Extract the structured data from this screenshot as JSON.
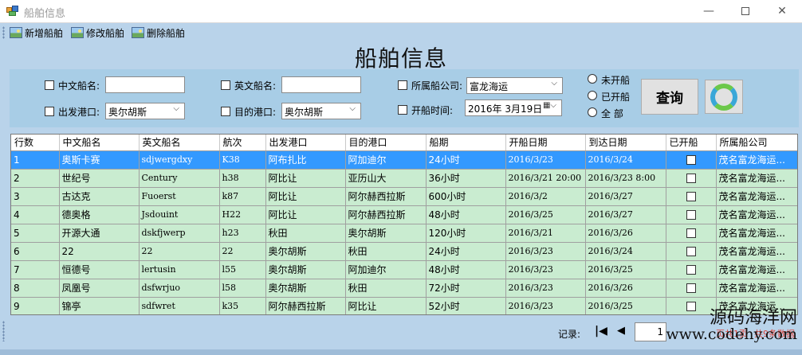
{
  "window": {
    "title": "船舶信息",
    "min": "—",
    "close": "✕"
  },
  "toolbar": {
    "add": "新增船舶",
    "edit": "修改船舶",
    "delete": "删除船舶"
  },
  "heading": "船舶信息",
  "filters": {
    "cn_name_label": "中文船名:",
    "en_name_label": "英文船名:",
    "company_label": "所属船公司:",
    "company_value": "富龙海运",
    "depart_label": "出发港口:",
    "depart_value": "奥尔胡斯",
    "dest_label": "目的港口:",
    "dest_value": "奥尔胡斯",
    "time_label": "开船时间:",
    "time_value": "2016年  3月19日",
    "radio_unsailed": "未开船",
    "radio_sailed": "已开船",
    "radio_all": "全  部",
    "query": "查询"
  },
  "grid": {
    "columns": [
      "行数",
      "中文船名",
      "英文船名",
      "航次",
      "出发港口",
      "目的港口",
      "船期",
      "开船日期",
      "到达日期",
      "已开船",
      "所属船公司"
    ],
    "rows": [
      [
        "1",
        "奥斯卡赛",
        "sdjwergdxy",
        "K38",
        "阿布扎比",
        "阿加迪尔",
        "24小时",
        "2016/3/23",
        "2016/3/24",
        "",
        "茂名富龙海运..."
      ],
      [
        "2",
        "世纪号",
        "Century",
        "h38",
        "阿比让",
        "亚历山大",
        "36小时",
        "2016/3/21 20:00",
        "2016/3/23 8:00",
        "",
        "茂名富龙海运..."
      ],
      [
        "3",
        "古达克",
        "Fuoerst",
        "k87",
        "阿比让",
        "阿尔赫西拉斯",
        "600小时",
        "2016/3/2",
        "2016/3/27",
        "",
        "茂名富龙海运..."
      ],
      [
        "4",
        "德奥格",
        "Jsdouint",
        "H22",
        "阿比让",
        "阿尔赫西拉斯",
        "48小时",
        "2016/3/25",
        "2016/3/27",
        "",
        "茂名富龙海运..."
      ],
      [
        "5",
        "开源大通",
        "dskfjwerp",
        "h23",
        "秋田",
        "奥尔胡斯",
        "120小时",
        "2016/3/21",
        "2016/3/26",
        "",
        "茂名富龙海运..."
      ],
      [
        "6",
        "22",
        "22",
        "22",
        "奥尔胡斯",
        "秋田",
        "24小时",
        "2016/3/23",
        "2016/3/24",
        "",
        "茂名富龙海运..."
      ],
      [
        "7",
        "恒德号",
        "lertusin",
        "l55",
        "奥尔胡斯",
        "阿加迪尔",
        "48小时",
        "2016/3/23",
        "2016/3/25",
        "",
        "茂名富龙海运..."
      ],
      [
        "8",
        "凤凰号",
        "dsfwrjuo",
        "l58",
        "奥尔胡斯",
        "秋田",
        "72小时",
        "2016/3/23",
        "2016/3/26",
        "",
        "茂名富龙海运..."
      ],
      [
        "9",
        "锦亭",
        "sdfwret",
        "k35",
        "阿尔赫西拉斯",
        "阿比让",
        "52小时",
        "2016/3/23",
        "2016/3/25",
        "",
        "茂名富龙海运..."
      ]
    ]
  },
  "pager": {
    "label": "记录:",
    "page": "1",
    "red_a": "页共1页",
    "red_b": "共9条数据"
  },
  "watermark": {
    "line1": "源码海洋网",
    "line2": "www.codehy.com"
  }
}
